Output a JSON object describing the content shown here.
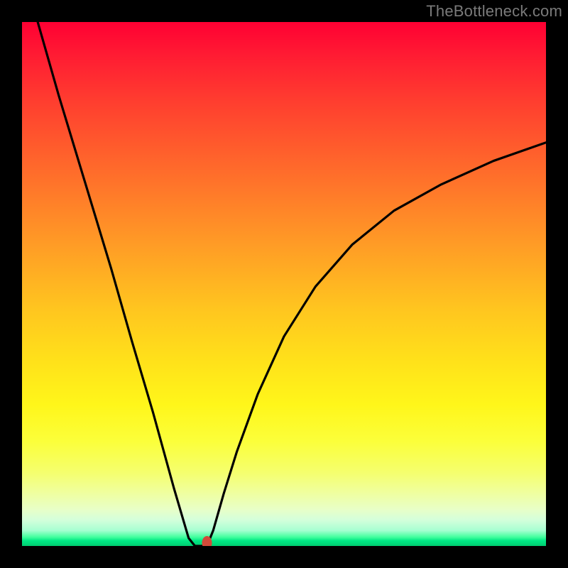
{
  "watermark": "TheBottleneck.com",
  "chart_data": {
    "type": "line",
    "title": "",
    "xlabel": "",
    "ylabel": "",
    "xlim": [
      0,
      100
    ],
    "ylim": [
      0,
      100
    ],
    "grid": false,
    "legend": false,
    "series": [
      {
        "name": "left-branch",
        "x": [
          3,
          7,
          12,
          17,
          21,
          25,
          29,
          31.8,
          33
        ],
        "values": [
          100,
          86,
          69.5,
          53,
          39,
          25.5,
          11,
          1.5,
          0
        ]
      },
      {
        "name": "valley-floor",
        "x": [
          33,
          34.5,
          35.3
        ],
        "values": [
          0,
          0,
          0
        ]
      },
      {
        "name": "right-branch",
        "x": [
          35.3,
          36.5,
          38.5,
          41,
          45,
          50,
          56,
          63,
          71,
          80,
          90,
          100
        ],
        "values": [
          0,
          3,
          10,
          18,
          29,
          40,
          49.5,
          57.5,
          64,
          69,
          73.5,
          77
        ]
      }
    ],
    "marker": {
      "x": 35.3,
      "y": 0.6,
      "color": "#d24a3a"
    },
    "background": {
      "type": "vertical-gradient",
      "stops": [
        {
          "pos": 0.0,
          "color": "#ff0033"
        },
        {
          "pos": 0.5,
          "color": "#ffbf20"
        },
        {
          "pos": 0.8,
          "color": "#faff48"
        },
        {
          "pos": 0.97,
          "color": "#b0ffd0"
        },
        {
          "pos": 1.0,
          "color": "#00cc6f"
        }
      ]
    }
  }
}
